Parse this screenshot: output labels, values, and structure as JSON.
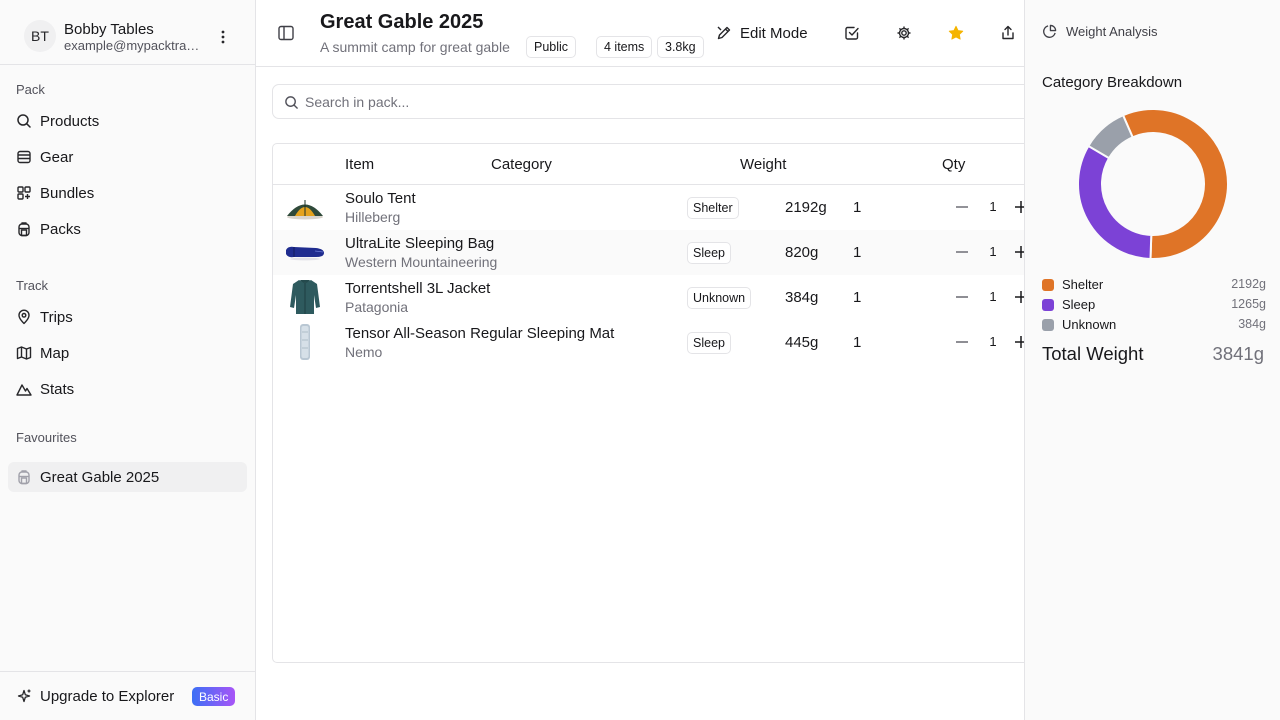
{
  "user": {
    "initials": "BT",
    "name": "Bobby Tables",
    "email": "example@mypacktracker.com"
  },
  "sidebar": {
    "sections": [
      {
        "label": "Pack",
        "items": [
          {
            "label": "Products",
            "icon": "search-icon"
          },
          {
            "label": "Gear",
            "icon": "gear-stack-icon"
          },
          {
            "label": "Bundles",
            "icon": "bundle-icon"
          },
          {
            "label": "Packs",
            "icon": "backpack-icon"
          }
        ]
      },
      {
        "label": "Track",
        "items": [
          {
            "label": "Trips",
            "icon": "map-pin-icon"
          },
          {
            "label": "Map",
            "icon": "map-icon"
          },
          {
            "label": "Stats",
            "icon": "mountain-icon"
          }
        ]
      },
      {
        "label": "Favourites",
        "items": [
          {
            "label": "Great Gable 2025",
            "icon": "backpack-icon",
            "active": true
          }
        ]
      }
    ],
    "upgrade": {
      "label": "Upgrade to Explorer",
      "badge": "Basic",
      "icon": "sparkles-icon"
    }
  },
  "header": {
    "title": "Great Gable 2025",
    "subtitle": "A summit camp for great gable",
    "chips": [
      "Public",
      "4 items",
      "3.8kg"
    ],
    "edit_mode_label": "Edit Mode",
    "favourite_color": "#f5b400"
  },
  "search": {
    "placeholder": "Search in pack...",
    "value": ""
  },
  "table": {
    "columns": [
      "Item",
      "Category",
      "Weight",
      "Qty"
    ],
    "rows": [
      {
        "name": "Soulo Tent",
        "brand": "Hilleberg",
        "category": "Shelter",
        "weight": "2192g",
        "qty": "1",
        "stepper": "1",
        "thumb": "tent"
      },
      {
        "name": "UltraLite Sleeping Bag",
        "brand": "Western Mountaineering",
        "category": "Sleep",
        "weight": "820g",
        "qty": "1",
        "stepper": "1",
        "thumb": "sleeping-bag"
      },
      {
        "name": "Torrentshell 3L Jacket",
        "brand": "Patagonia",
        "category": "Unknown",
        "weight": "384g",
        "qty": "1",
        "stepper": "1",
        "thumb": "jacket"
      },
      {
        "name": "Tensor All-Season Regular Sleeping Mat",
        "brand": "Nemo",
        "category": "Sleep",
        "weight": "445g",
        "qty": "1",
        "stepper": "1",
        "thumb": "mat"
      }
    ]
  },
  "panel": {
    "heading": "Weight Analysis",
    "breakdown_title": "Category Breakdown",
    "total_label": "Total Weight",
    "total_value": "3841g"
  },
  "chart_data": {
    "type": "pie",
    "categories": [
      "Shelter",
      "Sleep",
      "Unknown"
    ],
    "values": [
      2192,
      1265,
      384
    ],
    "labels": [
      "2192g",
      "1265g",
      "384g"
    ],
    "colors": [
      "#df7427",
      "#7c42d6",
      "#9aa0aa"
    ]
  }
}
